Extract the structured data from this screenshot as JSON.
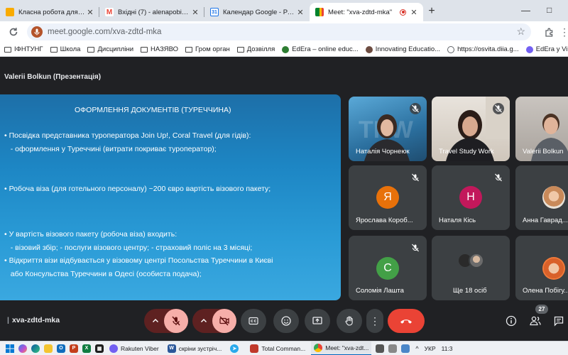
{
  "browser": {
    "tabs": [
      {
        "label": "Класна робота для курсу \"Гео",
        "icon": "classroom-icon",
        "color": "#f9ab00"
      },
      {
        "label": "Вхідні (7) - alenapobigun@gma",
        "icon": "gmail-icon",
        "color": "#ea4335"
      },
      {
        "label": "Календар Google - Розклад по",
        "icon": "calendar-icon",
        "color": "#1a73e8"
      },
      {
        "label": "Meet: \"xva-zdtd-mka\"",
        "icon": "meet-icon",
        "color": "#00832d",
        "active": true,
        "recording": true
      }
    ],
    "new_tab": "+",
    "url": "meet.google.com/xva-zdtd-mka",
    "bookmarks": [
      {
        "label": "ІФНТУНГ",
        "type": "folder"
      },
      {
        "label": "Школа",
        "type": "folder"
      },
      {
        "label": "Дисципліни",
        "type": "folder"
      },
      {
        "label": "НАЗЯВО",
        "type": "folder"
      },
      {
        "label": "Гром орган",
        "type": "folder"
      },
      {
        "label": "Дозвілля",
        "type": "folder"
      },
      {
        "label": "EdEra – online educ...",
        "type": "site",
        "color": "#2e7d32"
      },
      {
        "label": "Innovating Educatio...",
        "type": "site",
        "color": "#6d4c41"
      },
      {
        "label": "https://osvita.diia.g...",
        "type": "site",
        "color": "#5f6368"
      },
      {
        "label": "EdEra у Viber",
        "type": "site",
        "color": "#7360f2"
      }
    ]
  },
  "meet": {
    "presenter_label": "Valerii Bolkun (Презентація)",
    "meeting_code": "xva-zdtd-mka",
    "participants_count": "27",
    "slide": {
      "title": "ОФОРМЛЕННЯ ДОКУМЕНТІВ (ТУРЕЧЧИНА)",
      "lines": [
        "• Посвідка представника туроператора Join Up!, Coral Travel (для гідів):",
        "   - оформлення у Туреччині (витрати покриває туроператор);",
        "• Робоча віза (для готельного персоналу) ~200 євро вартість візового пакету;",
        "• У вартість візового пакету (робоча віза) входить:",
        "   - візовий збір; - послуги візового центру; - страховий поліс на 3 місяці;",
        "• Відкриття візи відбувається у візовому центрі Посольства Туреччини в Києві",
        "   або Консульства Туреччини в Одесі (особиста подача);"
      ]
    },
    "tiles": [
      {
        "name": "Наталія Чорнеюк",
        "type": "video",
        "muted": true
      },
      {
        "name": "Travel Study Work",
        "type": "video",
        "muted": true
      },
      {
        "name": "Valerii Bolkun",
        "type": "video",
        "muted": false
      },
      {
        "name": "Ярослава Короб...",
        "type": "initial",
        "initial": "Я",
        "color": "#e8710a",
        "muted": true
      },
      {
        "name": "Наталя Кісь",
        "type": "initial",
        "initial": "Н",
        "color": "#c2185b",
        "muted": true
      },
      {
        "name": "Анна Гаврад...",
        "type": "photo",
        "muted": false
      },
      {
        "name": "Соломія Лашта",
        "type": "initial",
        "initial": "С",
        "color": "#43a047",
        "muted": true
      },
      {
        "name": "Ще 18 осіб",
        "type": "group",
        "muted": false
      },
      {
        "name": "Олена Побігу...",
        "type": "photo",
        "muted": false
      }
    ]
  },
  "taskbar": {
    "apps": [
      {
        "label": "Rakuten Viber",
        "icon": "viber-icon",
        "color": "#7360f2"
      },
      {
        "label": "скріни зустріч...",
        "icon": "word-icon",
        "color": "#2b579a"
      },
      {
        "label": "",
        "icon": "telegram-icon",
        "color": "#29a9eb"
      },
      {
        "label": "Total Comman...",
        "icon": "total-commander-icon",
        "color": "#c0392b"
      },
      {
        "label": "Meet: \"xva-zdt...",
        "icon": "chrome-icon",
        "color": "#34a853",
        "active": true
      }
    ],
    "lang": "УКР",
    "time": "11:3"
  }
}
